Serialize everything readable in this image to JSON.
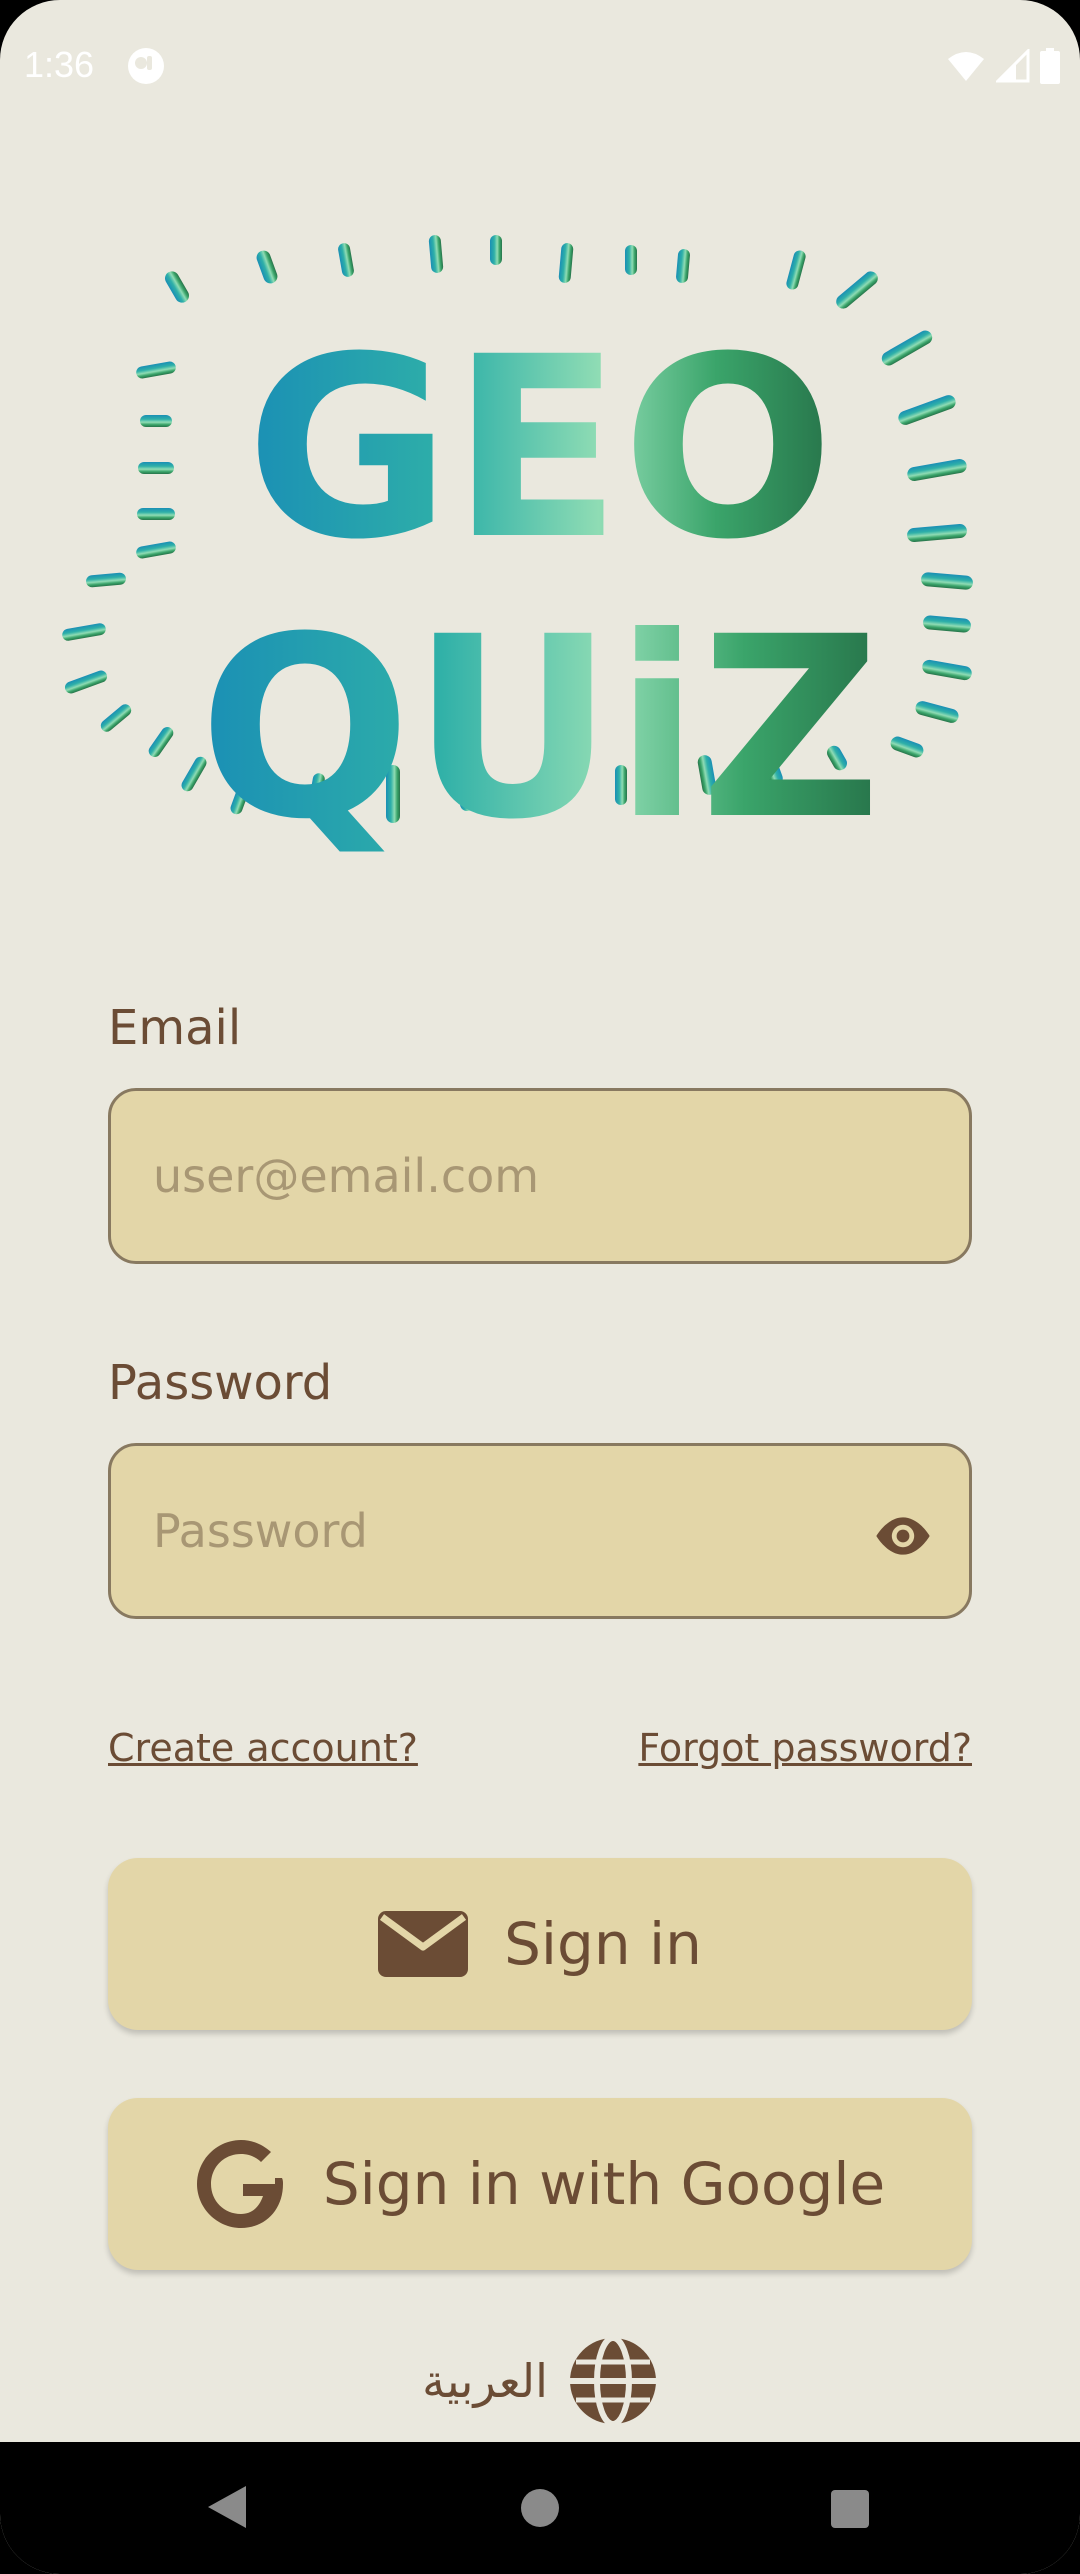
{
  "status_bar": {
    "time": "1:36",
    "icons": [
      "app-notification-icon",
      "wifi-icon",
      "signal-icon",
      "battery-icon"
    ]
  },
  "logo": {
    "line1": "GEO",
    "line2": "QUiZ",
    "colors": [
      "#1a8fb5",
      "#2fb0a8",
      "#8fdcb4",
      "#3aa46a",
      "#27744a"
    ]
  },
  "form": {
    "email_label": "Email",
    "email_placeholder": "user@email.com",
    "password_label": "Password",
    "password_placeholder": "Password",
    "create_account": "Create account?",
    "forgot_password": "Forgot password?"
  },
  "buttons": {
    "sign_in": "Sign in",
    "sign_in_google": "Sign in with Google"
  },
  "language": {
    "label": "العربية",
    "icon": "globe-icon"
  },
  "navigation": {
    "back": "back-icon",
    "home": "home-icon",
    "recents": "recents-icon"
  },
  "theme": {
    "background": "#eae8de",
    "field_fill": "#e3d6a8",
    "text_brown": "#6b4c35"
  }
}
